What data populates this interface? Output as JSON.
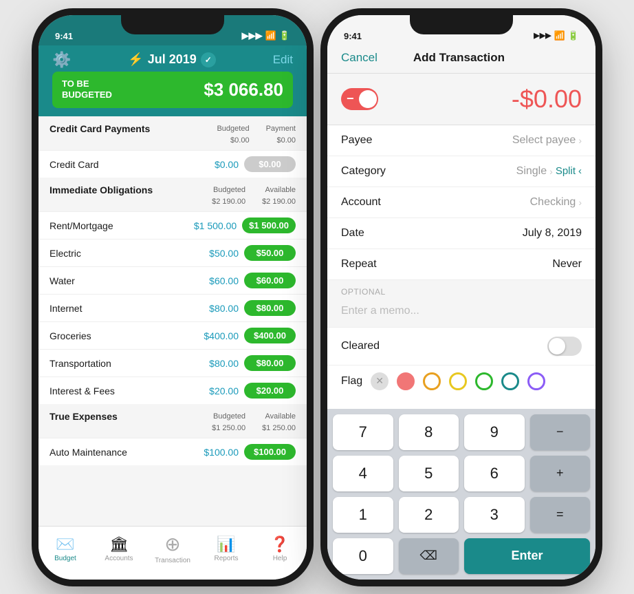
{
  "leftPhone": {
    "statusBar": {
      "time": "9:41",
      "battery": "🔋"
    },
    "header": {
      "month": "Jul 2019",
      "editLabel": "Edit"
    },
    "toBeBudgeted": {
      "label": "TO BE\nBUDGETED",
      "amount": "$3 066.80"
    },
    "sections": [
      {
        "title": "Credit Card Payments",
        "meta1Label": "Budgeted",
        "meta1Value": "$0.00",
        "meta2Label": "Payment",
        "meta2Value": "$0.00",
        "rows": [
          {
            "name": "Credit Card",
            "budgeted": "$0.00",
            "available": "$0.00",
            "availStyle": "gray"
          }
        ]
      },
      {
        "title": "Immediate Obligations",
        "meta1Label": "Budgeted",
        "meta1Value": "$2 190.00",
        "meta2Label": "Available",
        "meta2Value": "$2 190.00",
        "rows": [
          {
            "name": "Rent/Mortgage",
            "budgeted": "$1 500.00",
            "available": "$1 500.00",
            "availStyle": "green"
          },
          {
            "name": "Electric",
            "budgeted": "$50.00",
            "available": "$50.00",
            "availStyle": "green"
          },
          {
            "name": "Water",
            "budgeted": "$60.00",
            "available": "$60.00",
            "availStyle": "green"
          },
          {
            "name": "Internet",
            "budgeted": "$80.00",
            "available": "$80.00",
            "availStyle": "green"
          },
          {
            "name": "Groceries",
            "budgeted": "$400.00",
            "available": "$400.00",
            "availStyle": "green"
          },
          {
            "name": "Transportation",
            "budgeted": "$80.00",
            "available": "$80.00",
            "availStyle": "green"
          },
          {
            "name": "Interest & Fees",
            "budgeted": "$20.00",
            "available": "$20.00",
            "availStyle": "green"
          }
        ]
      },
      {
        "title": "True Expenses",
        "meta1Label": "Budgeted",
        "meta1Value": "$1 250.00",
        "meta2Label": "Available",
        "meta2Value": "$1 250.00",
        "rows": [
          {
            "name": "Auto Maintenance",
            "budgeted": "$100.00",
            "available": "$100.00",
            "availStyle": "green"
          }
        ]
      }
    ],
    "nav": [
      {
        "icon": "✉️",
        "label": "Budget",
        "active": true
      },
      {
        "icon": "🏛",
        "label": "Accounts",
        "active": false
      },
      {
        "icon": "⊕",
        "label": "Transaction",
        "active": false
      },
      {
        "icon": "📊",
        "label": "Reports",
        "active": false
      },
      {
        "icon": "❓",
        "label": "Help",
        "active": false
      }
    ]
  },
  "rightPhone": {
    "statusBar": {
      "time": "9:41"
    },
    "header": {
      "cancelLabel": "Cancel",
      "title": "Add Transaction"
    },
    "amount": "-$0.00",
    "form": {
      "payeeLabel": "Payee",
      "payeeValue": "Select payee",
      "categoryLabel": "Category",
      "categoryValue": "Single",
      "splitLabel": "Split",
      "accountLabel": "Account",
      "accountValue": "Checking",
      "dateLabel": "Date",
      "dateValue": "July 8, 2019",
      "repeatLabel": "Repeat",
      "repeatValue": "Never"
    },
    "optional": {
      "label": "OPTIONAL",
      "memoPlaceholder": "Enter a memo..."
    },
    "clearedLabel": "Cleared",
    "flagLabel": "Flag",
    "flags": [
      {
        "color": "#e55",
        "style": "filled"
      },
      {
        "color": "#e55",
        "style": "outline"
      },
      {
        "color": "#e8a020",
        "style": "outline"
      },
      {
        "color": "#2db82d",
        "style": "outline"
      },
      {
        "color": "#1a8a8a",
        "style": "outline"
      },
      {
        "color": "#8b5cf6",
        "style": "outline"
      }
    ],
    "numpad": {
      "keys": [
        "7",
        "8",
        "9",
        "−",
        "4",
        "5",
        "6",
        "+",
        "1",
        "2",
        "3",
        "=",
        "0",
        "⌫",
        "Enter"
      ]
    }
  }
}
